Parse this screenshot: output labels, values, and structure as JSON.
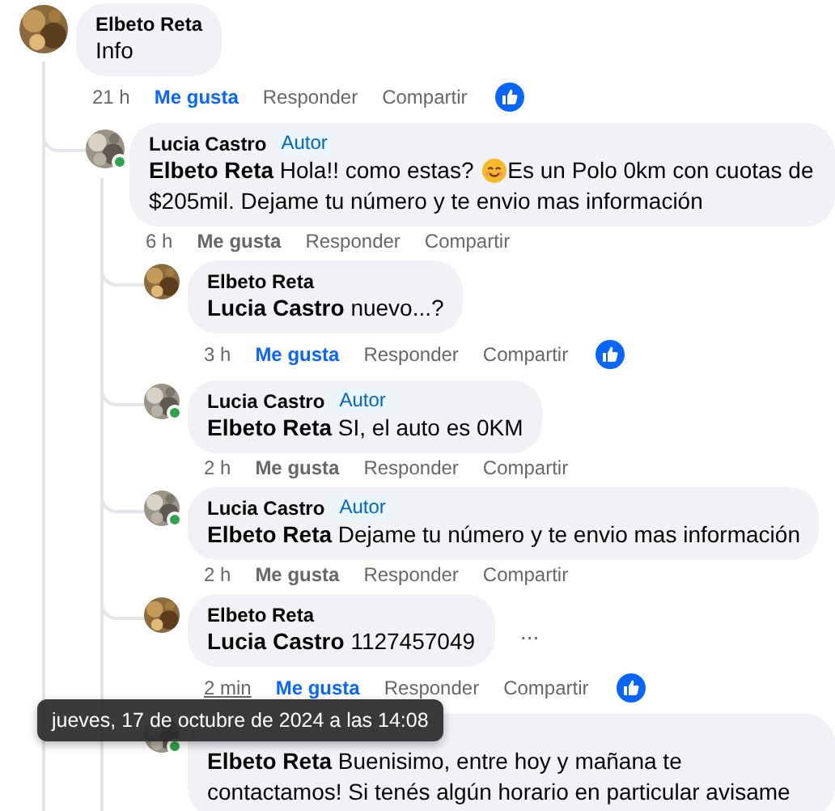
{
  "comment": {
    "author": "Elbeto Reta",
    "body": [
      {
        "kind": "text",
        "text": "Info"
      }
    ],
    "time": "21 h",
    "liked": true,
    "actions": [
      "Me gusta",
      "Responder",
      "Compartir"
    ],
    "reacted": true,
    "replies": [
      {
        "author": "Lucia Castro",
        "badge": "Autor",
        "online": true,
        "body": [
          {
            "kind": "text",
            "text": "**Elbeto Reta** Hola!! como estas? "
          },
          {
            "kind": "emoji"
          },
          {
            "kind": "text",
            "text": "Es un Polo 0km con cuotas de $205mil. Dejame tu número y te envio mas información"
          }
        ],
        "time": "6 h",
        "liked": false,
        "actions": [
          "Me gusta",
          "Responder",
          "Compartir"
        ],
        "replies": [
          {
            "author": "Elbeto Reta",
            "body": [
              {
                "kind": "text",
                "text": "**Lucia Castro** nuevo...?"
              }
            ],
            "time": "3 h",
            "liked": true,
            "actions": [
              "Me gusta",
              "Responder",
              "Compartir"
            ],
            "reacted": true
          },
          {
            "author": "Lucia Castro",
            "badge": "Autor",
            "online": true,
            "body": [
              {
                "kind": "text",
                "text": "**Elbeto Reta** SI, el auto es 0KM"
              }
            ],
            "time": "2 h",
            "liked": false,
            "actions": [
              "Me gusta",
              "Responder",
              "Compartir"
            ]
          },
          {
            "author": "Lucia Castro",
            "badge": "Autor",
            "online": true,
            "body": [
              {
                "kind": "text",
                "text": "**Elbeto Reta** Dejame tu número y te envio mas información"
              }
            ],
            "time": "2 h",
            "liked": false,
            "actions": [
              "Me gusta",
              "Responder",
              "Compartir"
            ]
          },
          {
            "author": "Elbeto Reta",
            "body": [
              {
                "kind": "text",
                "text": "**Lucia Castro** 1127457049"
              }
            ],
            "more": "...",
            "time": "2 min",
            "hovered": true,
            "time_tooltip": "jueves, 17 de octubre de 2024 a las 14:08",
            "liked": true,
            "actions": [
              "Me gusta",
              "Responder",
              "Compartir"
            ],
            "reacted": true
          },
          {
            "online": true,
            "body": [
              {
                "kind": "text",
                "text": "**Elbeto Reta** Buenisimo, entre hoy y mañana te contactamos! Si tenés algún horario en particular avisame"
              }
            ]
          }
        ]
      }
    ]
  }
}
